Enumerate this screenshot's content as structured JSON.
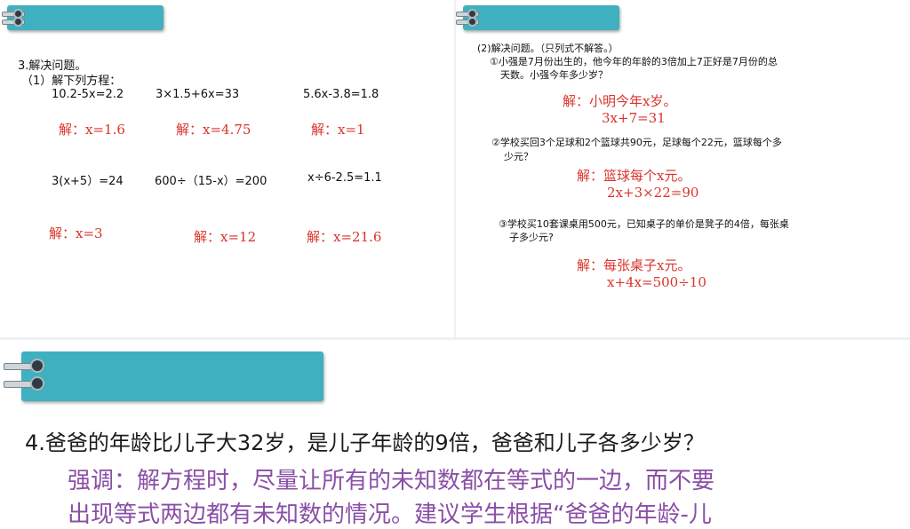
{
  "left": {
    "problem_title": "3.解决问题。",
    "sub_title": "（1）解下列方程：",
    "equations": [
      {
        "eq": "10.2-5x=2.2",
        "answer": "解：x=1.6"
      },
      {
        "eq": "3×1.5+6x=33",
        "answer": "解：x=4.75"
      },
      {
        "eq": "5.6x-3.8=1.8",
        "answer": "解：x=1"
      },
      {
        "eq": "3(x+5）=24",
        "answer": "解：x=3"
      },
      {
        "eq": "600÷（15-x）=200",
        "answer": "解：x=12"
      },
      {
        "eq": "x÷6-2.5=1.1",
        "answer": "解：x=21.6"
      }
    ]
  },
  "right": {
    "sub_title": "(2)解决问题。（只列式不解答。）",
    "questions": [
      {
        "line1": "①小强是7月份出生的，他今年的年龄的3倍加上7正好是7月份的总",
        "line2": "天数。小强今年多少岁？",
        "answer1": "解：小明今年x岁。",
        "answer2": "3x+7=31"
      },
      {
        "line1": "②学校买回3个足球和2个篮球共90元，足球每个22元，篮球每个多",
        "line2": "少元？",
        "answer1": "解：篮球每个x元。",
        "answer2": "2x+3×22=90"
      },
      {
        "line1": "③学校买10套课桌用500元，已知桌子的单价是凳子的4倍，每张桌",
        "line2": "子多少元?",
        "answer1": "解：每张桌子x元。",
        "answer2": "x+4x=500÷10"
      }
    ]
  },
  "bottom": {
    "question": "4.爸爸的年龄比儿子大32岁，是儿子年龄的9倍，爸爸和儿子各多少岁？",
    "note_line1": "强调：解方程时，尽量让所有的未知数都在等式的一边，而不要",
    "note_line2": "出现等式两边都有未知数的情况。建议学生根据“爸爸的年龄-儿"
  },
  "colors": {
    "banner": "#3fb0bf",
    "answer_red": "#d9342b",
    "note_purple": "#8a4fa6"
  }
}
